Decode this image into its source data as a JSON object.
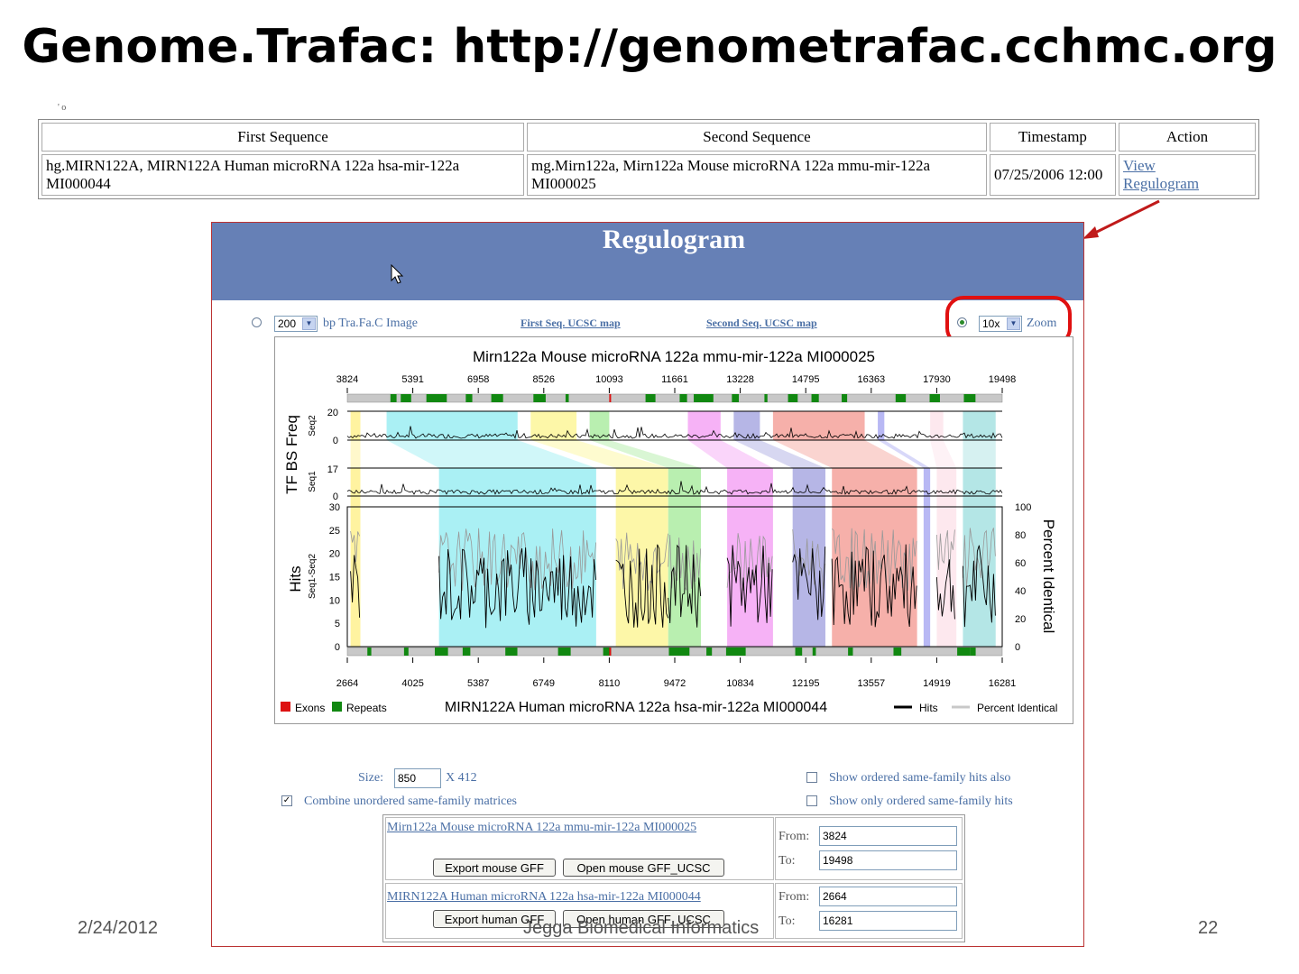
{
  "slide": {
    "title": "Genome.Trafac: http://genometrafac.cchmc.org",
    "corner_mark": "' o",
    "date": "2/24/2012",
    "footer": "Jegga Biomedical Informatics",
    "page": "22"
  },
  "table": {
    "headers": [
      "First Sequence",
      "Second Sequence",
      "Timestamp",
      "Action"
    ],
    "first_sequence": "hg.MIRN122A, MIRN122A Human microRNA 122a hsa-mir-122a MI000044",
    "second_sequence": "mg.Mirn122a, Mirn122a Mouse microRNA 122a mmu-mir-122a MI000025",
    "timestamp": "07/25/2006 12:00",
    "action_line1": "View",
    "action_line2": "Regulogram"
  },
  "regulogram": {
    "title": "Regulogram",
    "bp_value": "200",
    "bp_label": "bp Tra.Fa.C Image",
    "first_seq_link": "First Seq. UCSC map",
    "second_seq_link": "Second Seq. UCSC map",
    "zoom_value": "10x",
    "zoom_label": "Zoom",
    "size_label": "Size:",
    "size_value": "850",
    "size_suffix": "X 412",
    "combine_label": "Combine unordered same-family matrices",
    "show_ordered_also": "Show ordered same-family hits also",
    "show_only_ordered": "Show only ordered same-family hits",
    "seq1_link": "Mirn122a Mouse microRNA 122a mmu-mir-122a MI000025",
    "export_mouse": "Export mouse GFF",
    "open_mouse": "Open mouse GFF_UCSC",
    "seq2_link": "MIRN122A Human microRNA 122a hsa-mir-122a MI000044",
    "export_human": "Export human GFF",
    "open_human": "Open human GFF_UCSC",
    "from_label": "From:",
    "to_label": "To:",
    "mouse_from": "3824",
    "mouse_to": "19498",
    "human_from": "2664",
    "human_to": "16281"
  },
  "chart_data": {
    "type": "line",
    "title": "Mirn122a Mouse microRNA 122a mmu-mir-122a MI000025",
    "bottom_title": "MIRN122A Human microRNA 122a hsa-mir-122a MI000044",
    "top_axis_ticks": [
      "3824",
      "5391",
      "6958",
      "8526",
      "10093",
      "11661",
      "13228",
      "14795",
      "16363",
      "17930",
      "19498"
    ],
    "bottom_axis_ticks": [
      "2664",
      "4025",
      "5387",
      "6749",
      "8110",
      "9472",
      "10834",
      "12195",
      "13557",
      "14919",
      "16281"
    ],
    "tfbs_ylabel": "TF BS Freq",
    "seq2_label": "Seq2",
    "seq1_label": "Seq1",
    "seq2_ticks": [
      "20",
      "0"
    ],
    "seq1_ticks": [
      "17",
      "0"
    ],
    "hits_ylabel": "Hits",
    "hits_sub": "Seq1-Seq2",
    "hits_ticks": [
      "30",
      "25",
      "20",
      "15",
      "10",
      "5",
      "0"
    ],
    "right_ylabel": "Percent Identical",
    "pct_ticks": [
      "100",
      "80",
      "60",
      "40",
      "20",
      "0"
    ],
    "legend": [
      "Exons",
      "Repeats",
      "Hits",
      "Percent Identical"
    ],
    "colors": {
      "exons": "#dd1111",
      "repeats": "#118811",
      "hits": "#000000",
      "percent": "#c8c8c8"
    },
    "blocks": [
      {
        "color": "#fff3a0",
        "seq2": [
          0.005,
          0.02
        ],
        "seq1": [
          0.005,
          0.02
        ]
      },
      {
        "color": "#aaf0f4",
        "seq2": [
          0.06,
          0.26
        ],
        "seq1": [
          0.14,
          0.38
        ]
      },
      {
        "color": "#fdf7a8",
        "seq2": [
          0.28,
          0.35
        ],
        "seq1": [
          0.41,
          0.49
        ]
      },
      {
        "color": "#b9efb0",
        "seq2": [
          0.37,
          0.4
        ],
        "seq1": [
          0.49,
          0.54
        ]
      },
      {
        "color": "#f6b2f6",
        "seq2": [
          0.52,
          0.57
        ],
        "seq1": [
          0.58,
          0.65
        ]
      },
      {
        "color": "#b6b6e6",
        "seq2": [
          0.59,
          0.63
        ],
        "seq1": [
          0.68,
          0.73
        ]
      },
      {
        "color": "#f6b0aa",
        "seq2": [
          0.65,
          0.79
        ],
        "seq1": [
          0.74,
          0.87
        ]
      },
      {
        "color": "#b8b8f4",
        "seq2": [
          0.81,
          0.82
        ],
        "seq1": [
          0.88,
          0.89
        ]
      },
      {
        "color": "#fde8ee",
        "seq2": [
          0.89,
          0.91
        ],
        "seq1": [
          0.9,
          0.93
        ]
      },
      {
        "color": "#b4e6e6",
        "seq2": [
          0.94,
          0.99
        ],
        "seq1": [
          0.94,
          0.99
        ]
      }
    ]
  }
}
